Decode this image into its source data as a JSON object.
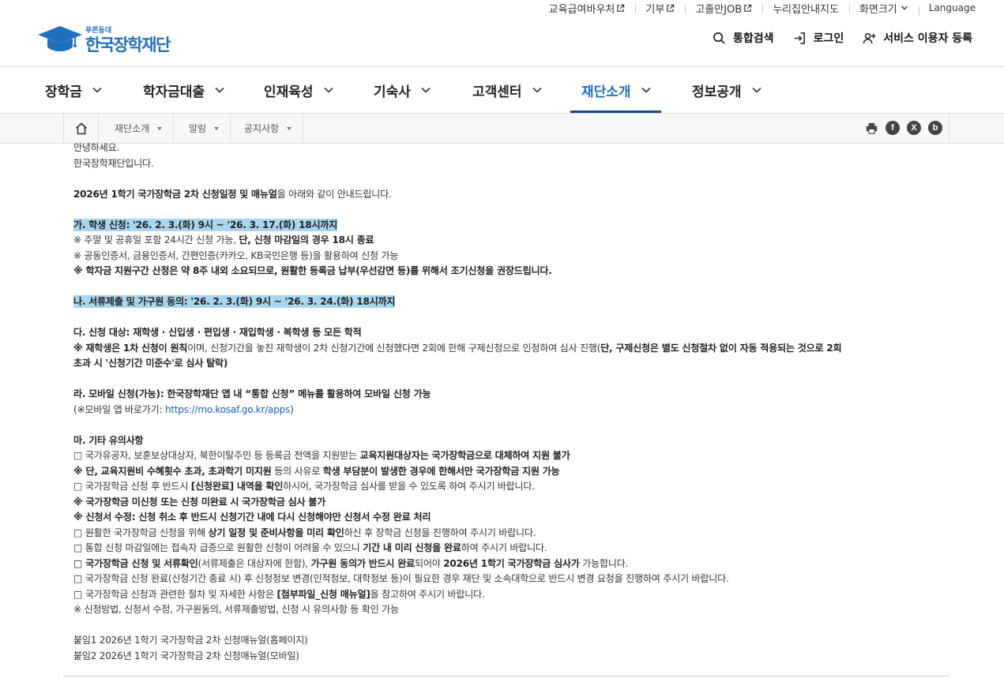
{
  "util": {
    "links": [
      "교육급여바우처",
      "기부",
      "고졸만JOB",
      "누리집안내지도",
      "화면크기",
      "Language"
    ]
  },
  "logo": {
    "sub": "푸른등대",
    "main": "한국장학재단"
  },
  "header": {
    "search": "통합검색",
    "login": "로그인",
    "register": "서비스 이용자 등록"
  },
  "gnb": [
    "장학금",
    "학자금대출",
    "인재육성",
    "기숙사",
    "고객센터",
    "재단소개",
    "정보공개"
  ],
  "breadcrumb": [
    "재단소개",
    "알림",
    "공지사항"
  ],
  "share": {
    "facebook": "f",
    "x": "X",
    "blog": "b"
  },
  "content": {
    "greet1": "안녕하세요.",
    "greet2": "한국장학재단입니다.",
    "intro_a": "2026년 1학기 국가장학금 2차 신청일정 및 매뉴얼",
    "intro_b": "을 아래와 같이 안내드립니다.",
    "ga": "가. 학생 신청: '26. 2. 3.(화) 9시 ~ '26. 3. 17.(화) 18시까지",
    "ga1_a": "※ 주말 및 공휴일 포함 24시간 신청 가능, ",
    "ga1_b": "단, 신청 마감일의 경우 18시 종료",
    "ga2": "※ 공동인증서, 금융인증서, 간편인증(카카오, KB국민은행 등)을 활용하여 신청 가능",
    "ga3": "※ 학자금 지원구간 산정은 약 8주 내외 소요되므로, 원활한 등록금 납부(우선감면 등)를 위해서 조기신청을 권장드립니다.",
    "na": "나. 서류제출 및 가구원 동의: '26. 2. 3.(화) 9시 ~ '26. 3. 24.(화) 18시까지",
    "da": "다. 신청 대상: 재학생 · 신입생 · 편입생 · 재입학생 · 복학생 등 모든 학적",
    "da1_a": "※ 재학생은 1차 신청이 원칙",
    "da1_b": "이며, 신청기간을 놓친 재학생이 2차 신청기간에 신청했다면 2회에 한해 구제신청으로 인정하여 심사 진행(",
    "da1_c": "단, 구제신청은 별도 신청절차 없이 자동 적용되는 것으로 2회",
    "da2": "초과 시 '신청기간 미준수'로 심사 탈락)",
    "ra": "라. 모바일 신청(가능): 한국장학재단 앱 내 “통합 신청” 메뉴를 활용하여 모바일 신청 가능",
    "ra1_a": "(※모바일 앱 바로가기: ",
    "ra1_link": "https://mo.kosaf.go.kr/apps",
    "ra1_b": ")",
    "ma": "마. 기타 유의사항",
    "m1_a": "□ 국가유공자, 보훈보상대상자, 북한이탈주민 등 등록금 전액을 지원받는 ",
    "m1_b": "교육지원대상자는 국가장학금으로 대체하여 지원 불가",
    "m2_a": "※ 단, 교육지원비 수혜횟수 초과, 초과학기 미지원",
    "m2_b": " 등의 사유로 ",
    "m2_c": "학생 부담분이 발생한 경우에 한해서만 국가장학금 지원 가능",
    "m3_a": "□ 국가장학금 신청 후 반드시 ",
    "m3_b": "[신청완료] 내역을 확인",
    "m3_c": "하시어, 국가장학금 심사를 받을 수 있도록 하여 주시기 바랍니다.",
    "m4": "※ 국가장학금 미신청 또는 신청 미완료 시 국가장학금 심사 불가",
    "m5": "※ 신청서 수정: 신청 취소 후 반드시 신청기간 내에 다시 신청해야만 신청서 수정 완료 처리",
    "m6_a": "□ 원활한 국가장학금 신청을 위해 ",
    "m6_b": "상기 일정 및 준비사항을 미리 확인",
    "m6_c": "하신 후 장학금 신청을 진행하여 주시기 바랍니다.",
    "m7_a": "□ 통합 신청 마감일에는 접속자 급증으로 원활한 신청이 어려울 수 있으니 ",
    "m7_b": "기간 내 미리 신청을 완료",
    "m7_c": "하여 주시기 바랍니다.",
    "m8_a": "□ 국가장학금 신청 및 서류확인",
    "m8_b": "(서류제출은 대상자에 한함), ",
    "m8_c": "가구원 동의가 반드시 완료",
    "m8_d": "되어야 ",
    "m8_e": "2026년 1학기 국가장학금 심사가",
    "m8_f": " 가능합니다.",
    "m9": "□ 국가장학금 신청 완료(신청기간 종료 시) 후 신청정보 변경(인적정보, 대학정보 등)이 필요한 경우 재단 및 소속대학으로 반드시 변경 요청을 진행하여 주시기 바랍니다.",
    "m10_a": "□ 국가장학금 신청과 관련한 절차 및 자세한 사항은 ",
    "m10_b": "[첨부파일_신청 매뉴얼]",
    "m10_c": "을 참고하여 주시기 바랍니다.",
    "m11": "※ 신청방법, 신청서 수정, 가구원동의, 서류제출방법, 신청 시 유의사항 등 확인 가능",
    "att1": "붙임1 2026년 1학기 국가장학금 2차 신청매뉴얼(홈페이지)",
    "att2": "붙임2 2026년 1학기 국가장학금 2차 신청매뉴얼(모바일)"
  }
}
